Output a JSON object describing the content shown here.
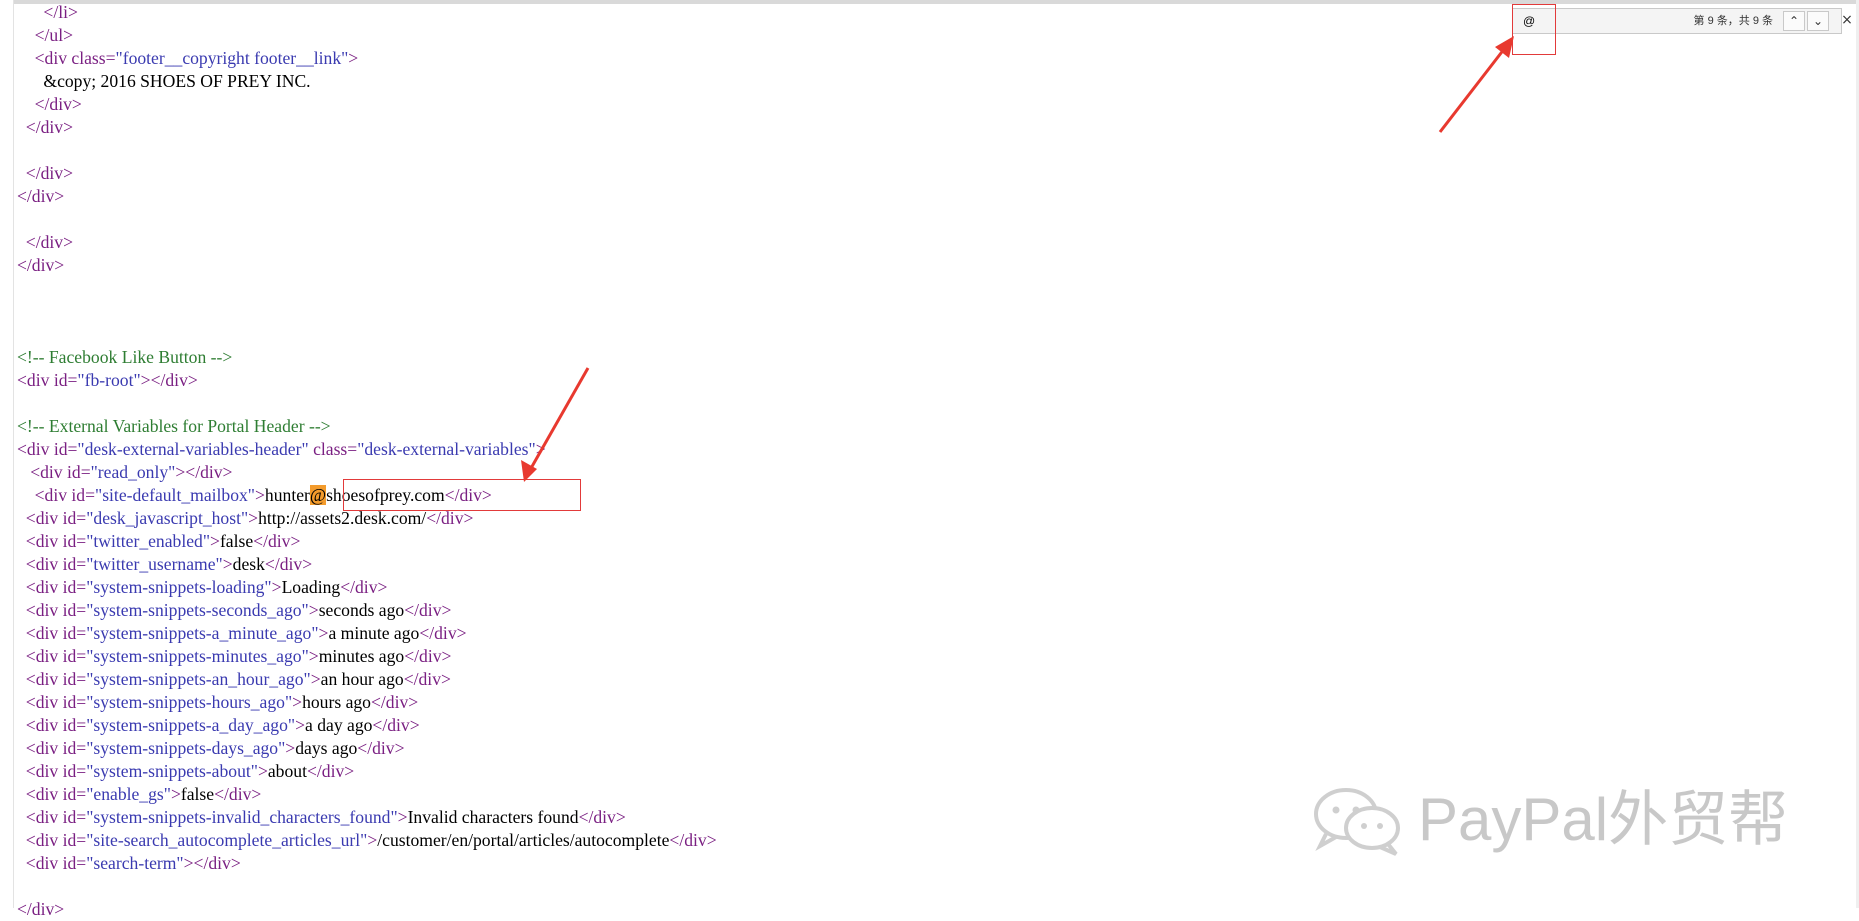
{
  "editor": {
    "lines": [
      [
        {
          "t": "      ",
          "c": "tx"
        },
        {
          "t": "</li>",
          "c": "tg"
        }
      ],
      [
        {
          "t": "    ",
          "c": "tx"
        },
        {
          "t": "</ul>",
          "c": "tg"
        }
      ],
      [
        {
          "t": "    ",
          "c": "tx"
        },
        {
          "t": "<div ",
          "c": "tg"
        },
        {
          "t": "class=",
          "c": "at"
        },
        {
          "t": "\"footer__copyright footer__link\"",
          "c": "vl"
        },
        {
          "t": ">",
          "c": "tg"
        }
      ],
      [
        {
          "t": "      &copy; 2016 SHOES OF PREY INC.",
          "c": "tx"
        }
      ],
      [
        {
          "t": "    ",
          "c": "tx"
        },
        {
          "t": "</div>",
          "c": "tg"
        }
      ],
      [
        {
          "t": "  ",
          "c": "tx"
        },
        {
          "t": "</div>",
          "c": "tg"
        }
      ],
      [
        {
          "t": "",
          "c": "tx"
        }
      ],
      [
        {
          "t": "  ",
          "c": "tx"
        },
        {
          "t": "</div>",
          "c": "tg"
        }
      ],
      [
        {
          "t": "</div>",
          "c": "tg"
        }
      ],
      [
        {
          "t": "",
          "c": "tx"
        }
      ],
      [
        {
          "t": "  ",
          "c": "tx"
        },
        {
          "t": "</div>",
          "c": "tg"
        }
      ],
      [
        {
          "t": "</div>",
          "c": "tg"
        }
      ],
      [
        {
          "t": "",
          "c": "tx"
        }
      ],
      [
        {
          "t": "",
          "c": "tx"
        }
      ],
      [
        {
          "t": "",
          "c": "tx"
        }
      ],
      [
        {
          "t": "<!-- Facebook Like Button -->",
          "c": "cm"
        }
      ],
      [
        {
          "t": "<div ",
          "c": "tg"
        },
        {
          "t": "id=",
          "c": "at"
        },
        {
          "t": "\"fb-root\"",
          "c": "vl"
        },
        {
          "t": "></div>",
          "c": "tg"
        }
      ],
      [
        {
          "t": "",
          "c": "tx"
        }
      ],
      [
        {
          "t": "<!-- External Variables for Portal Header -->",
          "c": "cm"
        }
      ],
      [
        {
          "t": "<div ",
          "c": "tg"
        },
        {
          "t": "id=",
          "c": "at"
        },
        {
          "t": "\"desk-external-variables-header\" ",
          "c": "vl"
        },
        {
          "t": "class=",
          "c": "at"
        },
        {
          "t": "\"desk-external-variables\"",
          "c": "vl"
        },
        {
          "t": ">",
          "c": "tg"
        }
      ],
      [
        {
          "t": "   ",
          "c": "tx"
        },
        {
          "t": "<div ",
          "c": "tg"
        },
        {
          "t": "id=",
          "c": "at"
        },
        {
          "t": "\"read_only\"",
          "c": "vl"
        },
        {
          "t": "></div>",
          "c": "tg"
        }
      ],
      [
        {
          "t": "    ",
          "c": "tx"
        },
        {
          "t": "<div ",
          "c": "tg"
        },
        {
          "t": "id=",
          "c": "at"
        },
        {
          "t": "\"site-default_mailbox\"",
          "c": "vl"
        },
        {
          "t": ">",
          "c": "tg"
        },
        {
          "t": "hunter",
          "c": "tx"
        },
        {
          "t": "@",
          "c": "hl"
        },
        {
          "t": "shoesofprey.com",
          "c": "tx"
        },
        {
          "t": "</div>",
          "c": "tg"
        }
      ],
      [
        {
          "t": "  ",
          "c": "tx"
        },
        {
          "t": "<div ",
          "c": "tg"
        },
        {
          "t": "id=",
          "c": "at"
        },
        {
          "t": "\"desk_javascript_host\"",
          "c": "vl"
        },
        {
          "t": ">",
          "c": "tg"
        },
        {
          "t": "http://assets2.desk.com/",
          "c": "tx"
        },
        {
          "t": "</div>",
          "c": "tg"
        }
      ],
      [
        {
          "t": "  ",
          "c": "tx"
        },
        {
          "t": "<div ",
          "c": "tg"
        },
        {
          "t": "id=",
          "c": "at"
        },
        {
          "t": "\"twitter_enabled\"",
          "c": "vl"
        },
        {
          "t": ">",
          "c": "tg"
        },
        {
          "t": "false",
          "c": "tx"
        },
        {
          "t": "</div>",
          "c": "tg"
        }
      ],
      [
        {
          "t": "  ",
          "c": "tx"
        },
        {
          "t": "<div ",
          "c": "tg"
        },
        {
          "t": "id=",
          "c": "at"
        },
        {
          "t": "\"twitter_username\"",
          "c": "vl"
        },
        {
          "t": ">",
          "c": "tg"
        },
        {
          "t": "desk",
          "c": "tx"
        },
        {
          "t": "</div>",
          "c": "tg"
        }
      ],
      [
        {
          "t": "  ",
          "c": "tx"
        },
        {
          "t": "<div ",
          "c": "tg"
        },
        {
          "t": "id=",
          "c": "at"
        },
        {
          "t": "\"system-snippets-loading\"",
          "c": "vl"
        },
        {
          "t": ">",
          "c": "tg"
        },
        {
          "t": "Loading",
          "c": "tx"
        },
        {
          "t": "</div>",
          "c": "tg"
        }
      ],
      [
        {
          "t": "  ",
          "c": "tx"
        },
        {
          "t": "<div ",
          "c": "tg"
        },
        {
          "t": "id=",
          "c": "at"
        },
        {
          "t": "\"system-snippets-seconds_ago\"",
          "c": "vl"
        },
        {
          "t": ">",
          "c": "tg"
        },
        {
          "t": "seconds ago",
          "c": "tx"
        },
        {
          "t": "</div>",
          "c": "tg"
        }
      ],
      [
        {
          "t": "  ",
          "c": "tx"
        },
        {
          "t": "<div ",
          "c": "tg"
        },
        {
          "t": "id=",
          "c": "at"
        },
        {
          "t": "\"system-snippets-a_minute_ago\"",
          "c": "vl"
        },
        {
          "t": ">",
          "c": "tg"
        },
        {
          "t": "a minute ago",
          "c": "tx"
        },
        {
          "t": "</div>",
          "c": "tg"
        }
      ],
      [
        {
          "t": "  ",
          "c": "tx"
        },
        {
          "t": "<div ",
          "c": "tg"
        },
        {
          "t": "id=",
          "c": "at"
        },
        {
          "t": "\"system-snippets-minutes_ago\"",
          "c": "vl"
        },
        {
          "t": ">",
          "c": "tg"
        },
        {
          "t": "minutes ago",
          "c": "tx"
        },
        {
          "t": "</div>",
          "c": "tg"
        }
      ],
      [
        {
          "t": "  ",
          "c": "tx"
        },
        {
          "t": "<div ",
          "c": "tg"
        },
        {
          "t": "id=",
          "c": "at"
        },
        {
          "t": "\"system-snippets-an_hour_ago\"",
          "c": "vl"
        },
        {
          "t": ">",
          "c": "tg"
        },
        {
          "t": "an hour ago",
          "c": "tx"
        },
        {
          "t": "</div>",
          "c": "tg"
        }
      ],
      [
        {
          "t": "  ",
          "c": "tx"
        },
        {
          "t": "<div ",
          "c": "tg"
        },
        {
          "t": "id=",
          "c": "at"
        },
        {
          "t": "\"system-snippets-hours_ago\"",
          "c": "vl"
        },
        {
          "t": ">",
          "c": "tg"
        },
        {
          "t": "hours ago",
          "c": "tx"
        },
        {
          "t": "</div>",
          "c": "tg"
        }
      ],
      [
        {
          "t": "  ",
          "c": "tx"
        },
        {
          "t": "<div ",
          "c": "tg"
        },
        {
          "t": "id=",
          "c": "at"
        },
        {
          "t": "\"system-snippets-a_day_ago\"",
          "c": "vl"
        },
        {
          "t": ">",
          "c": "tg"
        },
        {
          "t": "a day ago",
          "c": "tx"
        },
        {
          "t": "</div>",
          "c": "tg"
        }
      ],
      [
        {
          "t": "  ",
          "c": "tx"
        },
        {
          "t": "<div ",
          "c": "tg"
        },
        {
          "t": "id=",
          "c": "at"
        },
        {
          "t": "\"system-snippets-days_ago\"",
          "c": "vl"
        },
        {
          "t": ">",
          "c": "tg"
        },
        {
          "t": "days ago",
          "c": "tx"
        },
        {
          "t": "</div>",
          "c": "tg"
        }
      ],
      [
        {
          "t": "  ",
          "c": "tx"
        },
        {
          "t": "<div ",
          "c": "tg"
        },
        {
          "t": "id=",
          "c": "at"
        },
        {
          "t": "\"system-snippets-about\"",
          "c": "vl"
        },
        {
          "t": ">",
          "c": "tg"
        },
        {
          "t": "about",
          "c": "tx"
        },
        {
          "t": "</div>",
          "c": "tg"
        }
      ],
      [
        {
          "t": "  ",
          "c": "tx"
        },
        {
          "t": "<div ",
          "c": "tg"
        },
        {
          "t": "id=",
          "c": "at"
        },
        {
          "t": "\"enable_gs\"",
          "c": "vl"
        },
        {
          "t": ">",
          "c": "tg"
        },
        {
          "t": "false",
          "c": "tx"
        },
        {
          "t": "</div>",
          "c": "tg"
        }
      ],
      [
        {
          "t": "  ",
          "c": "tx"
        },
        {
          "t": "<div ",
          "c": "tg"
        },
        {
          "t": "id=",
          "c": "at"
        },
        {
          "t": "\"system-snippets-invalid_characters_found\"",
          "c": "vl"
        },
        {
          "t": ">",
          "c": "tg"
        },
        {
          "t": "Invalid characters found",
          "c": "tx"
        },
        {
          "t": "</div>",
          "c": "tg"
        }
      ],
      [
        {
          "t": "  ",
          "c": "tx"
        },
        {
          "t": "<div ",
          "c": "tg"
        },
        {
          "t": "id=",
          "c": "at"
        },
        {
          "t": "\"site-search_autocomplete_articles_url\"",
          "c": "vl"
        },
        {
          "t": ">",
          "c": "tg"
        },
        {
          "t": "/customer/en/portal/articles/autocomplete",
          "c": "tx"
        },
        {
          "t": "</div>",
          "c": "tg"
        }
      ],
      [
        {
          "t": "  ",
          "c": "tx"
        },
        {
          "t": "<div ",
          "c": "tg"
        },
        {
          "t": "id=",
          "c": "at"
        },
        {
          "t": "\"search-term\"",
          "c": "vl"
        },
        {
          "t": "></div>",
          "c": "tg"
        }
      ],
      [
        {
          "t": "",
          "c": "tx"
        }
      ],
      [
        {
          "t": "</div>",
          "c": "tg"
        }
      ]
    ]
  },
  "find_bar": {
    "query": "@",
    "match_count": "第 9 条，共 9 条",
    "prev_icon": "chevron-up-icon",
    "next_icon": "chevron-down-icon",
    "close_icon": "close-icon"
  },
  "watermark": {
    "text": "PayPal外贸帮",
    "icon": "wechat-icon"
  },
  "colors": {
    "tag": "#7a1f82",
    "attr_value": "#3a3ab0",
    "comment": "#2e7d32",
    "search_highlight": "#f39b2c",
    "annotation_red": "#e23a3a"
  }
}
